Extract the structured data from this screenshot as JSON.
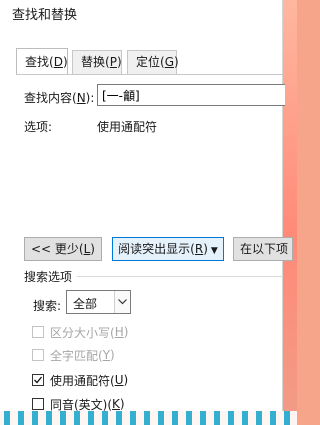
{
  "window": {
    "title": "查找和替换"
  },
  "tabs": [
    {
      "label": "查找(",
      "key": "D",
      "tail": ")"
    },
    {
      "label": "替换(",
      "key": "P",
      "tail": ")"
    },
    {
      "label": "定位(",
      "key": "G",
      "tail": ")"
    }
  ],
  "find": {
    "label_prefix": "查找内容(",
    "label_key": "N",
    "label_suffix": "):",
    "value": "[一-龥]"
  },
  "options": {
    "label": "选项:",
    "value": "使用通配符"
  },
  "buttons": {
    "less_prefix": "<< 更少(",
    "less_key": "L",
    "less_suffix": ")",
    "reading_prefix": "阅读突出显示(",
    "reading_key": "R",
    "reading_suffix": ")",
    "find_in": "在以下项"
  },
  "search_options": {
    "heading": "搜索选项",
    "search_label_prefix": "搜索",
    "search_label_suffix": ":",
    "search_value": "全部",
    "checkboxes": [
      {
        "prefix": "区分大小写(",
        "key": "H",
        "suffix": ")",
        "checked": false,
        "disabled": true
      },
      {
        "prefix": "全字匹配(",
        "key": "Y",
        "suffix": ")",
        "checked": false,
        "disabled": true
      },
      {
        "prefix": "使用通配符(",
        "key": "U",
        "suffix": ")",
        "checked": true,
        "disabled": false
      },
      {
        "prefix": "同音(英文)(",
        "key": "K",
        "suffix": ")",
        "checked": false,
        "disabled": false
      }
    ]
  },
  "icons": {
    "checkmark": "check-icon",
    "dropdown": "chevron-down-icon",
    "split_caret": "caret-down-icon"
  },
  "colors": {
    "primary_button_border": "#0078d7",
    "primary_button_fill": "#e5f1fb"
  }
}
